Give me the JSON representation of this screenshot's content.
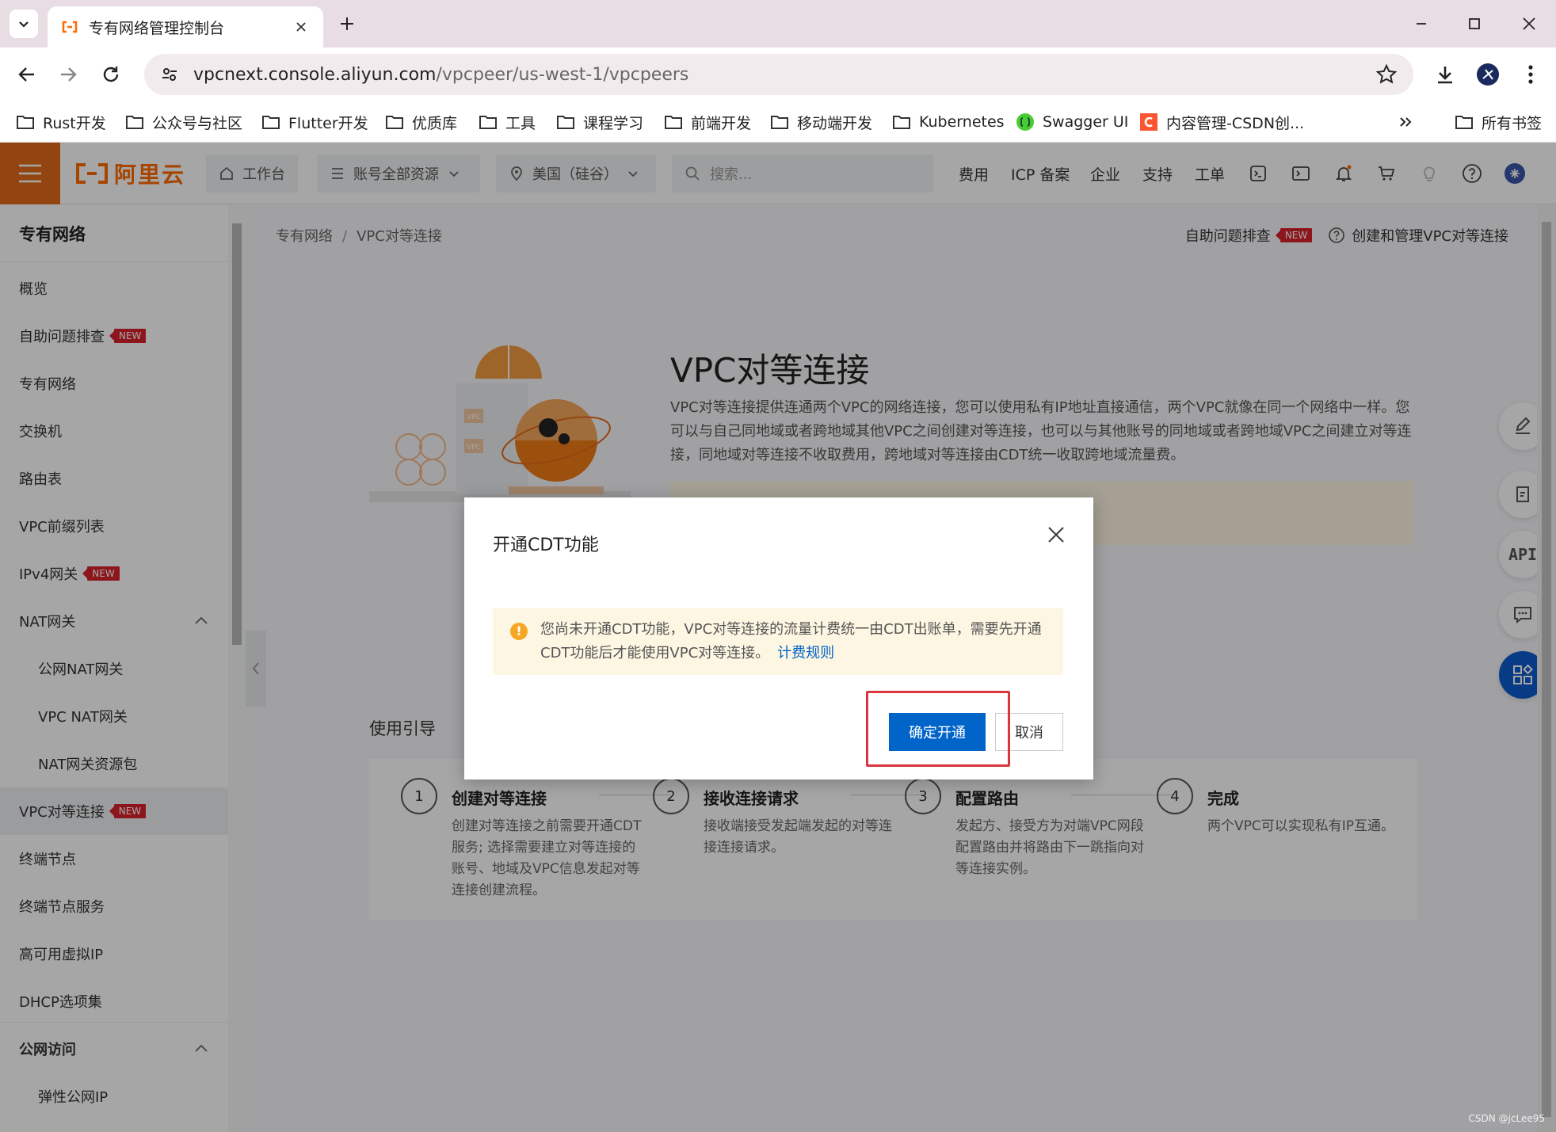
{
  "browser": {
    "tab_title": "专有网络管理控制台",
    "url_host": "vpcnext.console.aliyun.com",
    "url_path": "/vpcpeer/us-west-1/vpcpeers",
    "bookmarks": [
      "Rust开发",
      "公众号与社区",
      "Flutter开发",
      "优质库",
      "工具",
      "课程学习",
      "前端开发",
      "移动端开发",
      "Kubernetes",
      "Swagger UI",
      "内容管理-CSDN创...",
      "所有书签"
    ]
  },
  "header": {
    "logo_text": "阿里云",
    "workbench": "工作台",
    "resources": "账号全部资源",
    "region": "美国（硅谷）",
    "search_placeholder": "搜索...",
    "links": [
      "费用",
      "ICP 备案",
      "企业",
      "支持",
      "工单"
    ]
  },
  "sidebar": {
    "title": "专有网络",
    "badge": "NEW",
    "items": [
      {
        "label": "概览"
      },
      {
        "label": "自助问题排查",
        "badge": "NEW"
      },
      {
        "label": "专有网络"
      },
      {
        "label": "交换机"
      },
      {
        "label": "路由表"
      },
      {
        "label": "VPC前缀列表"
      },
      {
        "label": "IPv4网关",
        "badge": "NEW"
      },
      {
        "label": "NAT网关"
      },
      {
        "label": "公网NAT网关"
      },
      {
        "label": "VPC NAT网关"
      },
      {
        "label": "NAT网关资源包"
      },
      {
        "label": "VPC对等连接",
        "badge": "NEW"
      },
      {
        "label": "终端节点"
      },
      {
        "label": "终端节点服务"
      },
      {
        "label": "高可用虚拟IP"
      },
      {
        "label": "DHCP选项集"
      },
      {
        "label": "公网访问"
      },
      {
        "label": "弹性公网IP"
      }
    ]
  },
  "main": {
    "breadcrumb": [
      "专有网络",
      "VPC对等连接"
    ],
    "self_check": "自助问题排查",
    "badge": "NEW",
    "help_link": "创建和管理VPC对等连接",
    "hero_title": "VPC对等连接",
    "hero_desc": "VPC对等连接提供连通两个VPC的网络连接，您可以使用私有IP地址直接通信，两个VPC就像在同一个网络中一样。您可以与自己同地域或者跨地域其他VPC之间创建对等连接，也可以与其他账号的同地域或者跨地域VPC之间建立对等连接，同地域对等连接不收取费用，跨地域对等连接由CDT统一收取跨地域流量费。",
    "guide_title": "使用引导",
    "steps": [
      {
        "num": "1",
        "title": "创建对等连接",
        "desc": "创建对等连接之前需要开通CDT服务; 选择需要建立对等连接的账号、地域及VPC信息发起对等连接创建流程。"
      },
      {
        "num": "2",
        "title": "接收连接请求",
        "desc": "接收端接受发起端发起的对等连接连接请求。"
      },
      {
        "num": "3",
        "title": "配置路由",
        "desc": "发起方、接受方为对端VPC网段配置路由并将路由下一跳指向对等连接实例。"
      },
      {
        "num": "4",
        "title": "完成",
        "desc": "两个VPC可以实现私有IP互通。"
      }
    ],
    "illustration_labels": [
      "VPC",
      "VPC"
    ]
  },
  "modal": {
    "title": "开通CDT功能",
    "alert_text": "您尚未开通CDT功能，VPC对等连接的流量计费统一由CDT出账单，需要先开通CDT功能后才能使用VPC对等连接。",
    "alert_link": "计费规则",
    "confirm": "确定开通",
    "cancel": "取消"
  },
  "watermark": "CSDN @jcLee95",
  "float_api": "API",
  "colors": {
    "brand_orange": "#ff6a00",
    "primary_blue": "#0064c8",
    "highlight_red": "#d9363e",
    "new_badge": "#d9232d"
  }
}
